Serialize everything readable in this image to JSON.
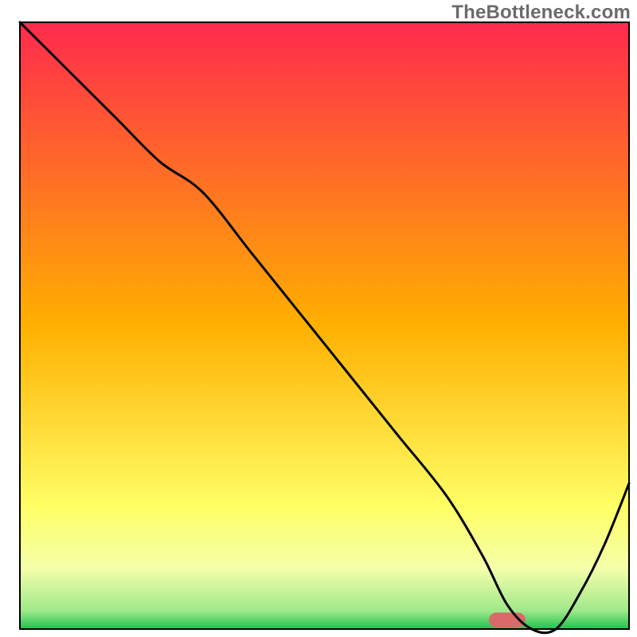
{
  "watermark": "TheBottleneck.com",
  "chart_data": {
    "type": "line",
    "title": "",
    "xlabel": "",
    "ylabel": "",
    "xlim": [
      0,
      100
    ],
    "ylim": [
      0,
      100
    ],
    "background_gradient": {
      "type": "vertical",
      "stops": [
        {
          "offset": 0,
          "color": "#ff2a4d"
        },
        {
          "offset": 50,
          "color": "#ffb000"
        },
        {
          "offset": 80,
          "color": "#ffff66"
        },
        {
          "offset": 90,
          "color": "#f5ffaa"
        },
        {
          "offset": 97,
          "color": "#9fe88a"
        },
        {
          "offset": 100,
          "color": "#1fc24e"
        }
      ]
    },
    "series": [
      {
        "name": "bottleneck-curve",
        "color": "#000000",
        "width": 3,
        "x": [
          0,
          8,
          16,
          23,
          30,
          38,
          46,
          54,
          62,
          70,
          76,
          80,
          84,
          88,
          92,
          96,
          100
        ],
        "y": [
          100,
          92,
          84,
          77,
          72,
          62,
          52,
          42,
          32,
          22,
          12,
          4,
          0,
          0,
          6,
          14,
          24
        ]
      }
    ],
    "marker": {
      "name": "sweet-spot-pill",
      "color": "#d86a6a",
      "x_start": 77,
      "x_end": 83,
      "y": 1.5,
      "height": 2.4
    }
  }
}
